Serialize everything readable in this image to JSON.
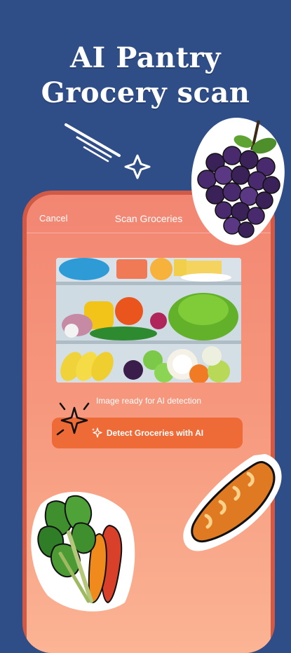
{
  "promo": {
    "title_line1": "AI Pantry",
    "title_line2": "Grocery scan"
  },
  "screen": {
    "cancel_label": "Cancel",
    "title": "Scan Groceries",
    "status_text": "Image ready for AI detection",
    "detect_button_label": "Detect Groceries with AI"
  },
  "colors": {
    "background": "#2f4d87",
    "button": "#ee6a37",
    "screen_top": "#f28672",
    "screen_bottom": "#fbb494"
  }
}
